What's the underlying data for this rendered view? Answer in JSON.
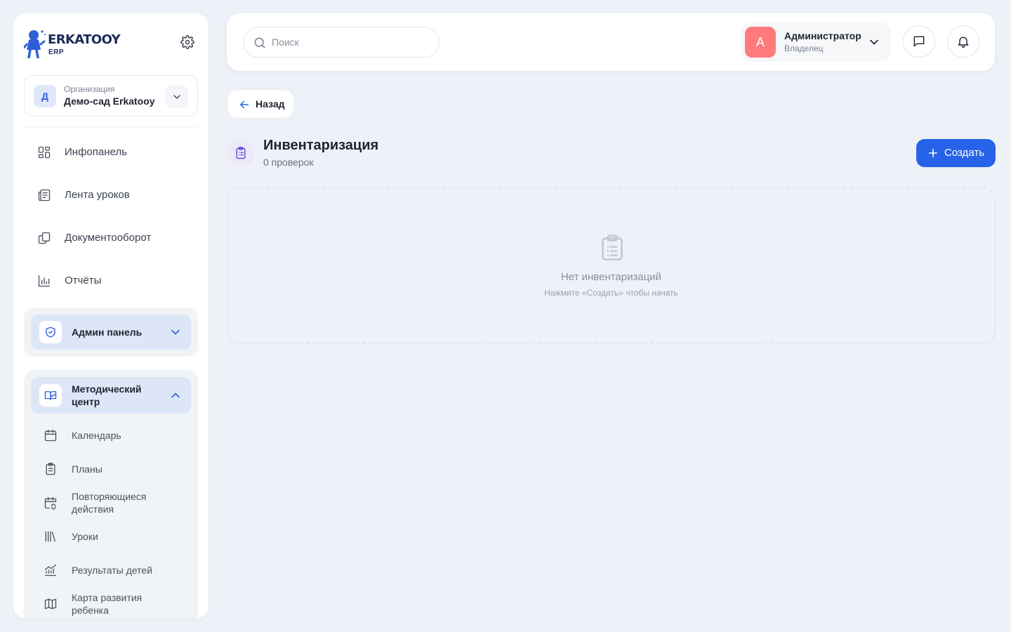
{
  "brand": {
    "name": "ERKATOOY",
    "sub": "ERP"
  },
  "organization": {
    "label": "Организация",
    "name": "Демо-сад Erkatooy",
    "avatar_letter": "Д"
  },
  "sidebar": {
    "items": [
      {
        "label": "Инфопанель",
        "icon": "dashboard-icon"
      },
      {
        "label": "Лента уроков",
        "icon": "news-feed-icon"
      },
      {
        "label": "Документооборот",
        "icon": "documents-icon"
      },
      {
        "label": "Отчёты",
        "icon": "bar-chart-icon"
      }
    ],
    "admin_group": {
      "label": "Админ панель",
      "icon": "shield-icon",
      "expanded": false
    },
    "method_group": {
      "label_line1": "Методический",
      "label_line2": "центр",
      "icon": "book-check-icon",
      "expanded": true,
      "items": [
        {
          "label": "Календарь",
          "icon": "calendar-icon"
        },
        {
          "label": "Планы",
          "icon": "clipboard-icon"
        },
        {
          "label_line1": "Повторяющиеся",
          "label_line2": "действия",
          "icon": "calendar-repeat-icon"
        },
        {
          "label": "Уроки",
          "icon": "library-icon"
        },
        {
          "label": "Результаты детей",
          "icon": "chart-line-icon"
        },
        {
          "label_line1": "Карта развития",
          "label_line2": "ребенка",
          "icon": "map-icon"
        }
      ]
    }
  },
  "header": {
    "search": {
      "placeholder": "Поиск",
      "value": ""
    },
    "user": {
      "avatar_letter": "А",
      "name": "Администратор",
      "role": "Владелец",
      "avatar_color": "#ff7b7b"
    }
  },
  "page": {
    "back_label": "Назад",
    "title": "Инвентаризация",
    "subtitle": "0 проверок",
    "create_label": "Создать",
    "empty_title": "Нет инвентаризаций",
    "empty_hint": "Нажмите «Создать» чтобы начать"
  },
  "colors": {
    "accent": "#2663e8",
    "background": "#eef1f8",
    "group_active": "#dde6f7"
  }
}
